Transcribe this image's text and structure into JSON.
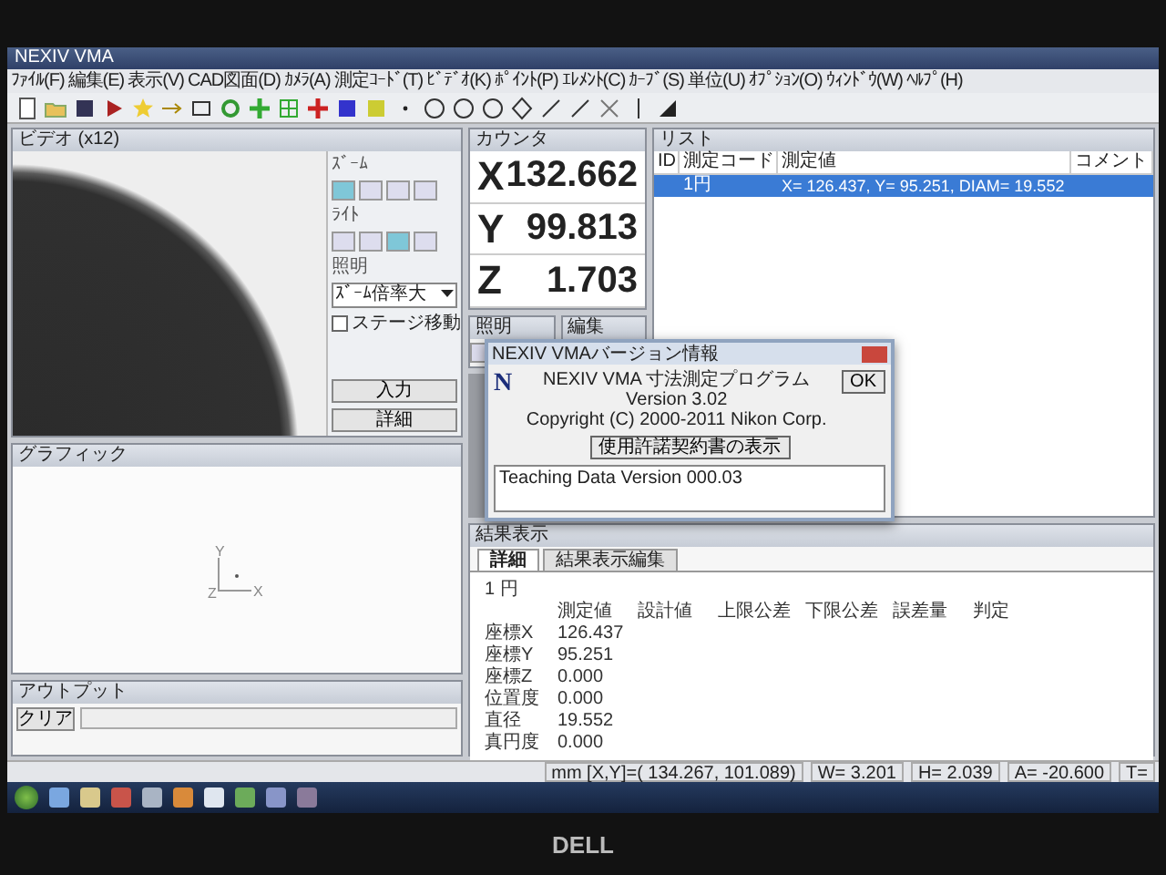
{
  "window": {
    "title": "NEXIV VMA"
  },
  "menu": [
    "ﾌｧｲﾙ(F)",
    "編集(E)",
    "表示(V)",
    "CAD図面(D)",
    "ｶﾒﾗ(A)",
    "測定ｺｰﾄﾞ(T)",
    "ﾋﾞﾃﾞｵ(K)",
    "ﾎﾟｲﾝﾄ(P)",
    "ｴﾚﾒﾝﾄ(C)",
    "ｶｰﾌﾞ(S)",
    "単位(U)",
    "ｵﾌﾟｼｮﾝ(O)",
    "ｳｨﾝﾄﾞｳ(W)",
    "ﾍﾙﾌﾟ(H)"
  ],
  "video": {
    "title": "ビデオ (x12)",
    "zoom_label": "ｽﾞｰﾑ",
    "light_label": "ﾗｲﾄ",
    "focus_label": "照明",
    "dropdown": "ｽﾞｰﾑ倍率大",
    "stage_move": {
      "label": "ステージ移動",
      "checked": false
    },
    "buttons": [
      "入力",
      "詳細"
    ]
  },
  "counter": {
    "title": "カウンタ",
    "axes": [
      {
        "axis": "X",
        "value": "132.662"
      },
      {
        "axis": "Y",
        "value": "99.813"
      },
      {
        "axis": "Z",
        "value": "1.703"
      }
    ]
  },
  "tool_panels": [
    "照明",
    "編集"
  ],
  "dialog": {
    "title": "NEXIV VMAバージョン情報",
    "logo": "N",
    "lines": [
      "NEXIV VMA 寸法測定プログラム",
      "Version 3.02",
      "Copyright (C) 2000-2011 Nikon Corp."
    ],
    "ok": "OK",
    "license_button": "使用許諾契約書の表示",
    "info": "Teaching Data Version 000.03"
  },
  "graphic": {
    "title": "グラフィック",
    "axis_labels": [
      "Y",
      "Z",
      "X"
    ]
  },
  "output": {
    "title": "アウトプット",
    "clear": "クリア"
  },
  "list": {
    "title": "リスト",
    "columns": [
      "ID",
      "測定コード",
      "測定値",
      "コメント"
    ],
    "rows": [
      {
        "id": "",
        "code": "1円",
        "value": "X= 126.437, Y= 95.251, DIAM= 19.552",
        "comment": "",
        "selected": true
      }
    ]
  },
  "results": {
    "title": "結果表示",
    "tabs": [
      {
        "label": "詳細",
        "selected": true
      },
      {
        "label": "結果表示編集",
        "selected": false
      }
    ],
    "element": "1 円",
    "columns": [
      "測定値",
      "設計値",
      "上限公差",
      "下限公差",
      "誤差量",
      "判定"
    ],
    "rows": [
      {
        "name": "座標X",
        "value": "126.437"
      },
      {
        "name": "座標Y",
        "value": "95.251"
      },
      {
        "name": "座標Z",
        "value": "0.000"
      },
      {
        "name": "位置度",
        "value": "0.000"
      },
      {
        "name": "直径",
        "value": "19.552"
      },
      {
        "name": "真円度",
        "value": "0.000"
      }
    ]
  },
  "status_bar": [
    "mm [X,Y]=( 134.267, 101.089)",
    "W= 3.201",
    "H= 2.039",
    "A= -20.600",
    "T="
  ],
  "monitor": {
    "brand": "DELL"
  }
}
